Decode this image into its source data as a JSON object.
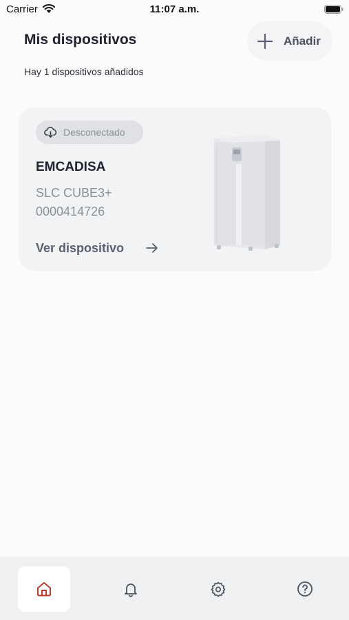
{
  "status_bar": {
    "carrier": "Carrier",
    "time": "11:07 a.m."
  },
  "header": {
    "title": "Mis dispositivos",
    "add_label": "Añadir",
    "subtitle": "Hay 1 dispositivos añadidos"
  },
  "devices": [
    {
      "status": "Desconectado",
      "name": "EMCADISA",
      "model": "SLC CUBE3+",
      "serial": "0000414726",
      "action_label": "Ver dispositivo"
    }
  ],
  "bottom_nav": [
    {
      "icon": "home-icon",
      "active": true
    },
    {
      "icon": "bell-icon",
      "active": false
    },
    {
      "icon": "gear-icon",
      "active": false
    },
    {
      "icon": "help-icon",
      "active": false
    }
  ],
  "colors": {
    "accent": "#c0392b",
    "card_bg": "#f2f3f5",
    "nav_bg": "#eef0f2"
  }
}
